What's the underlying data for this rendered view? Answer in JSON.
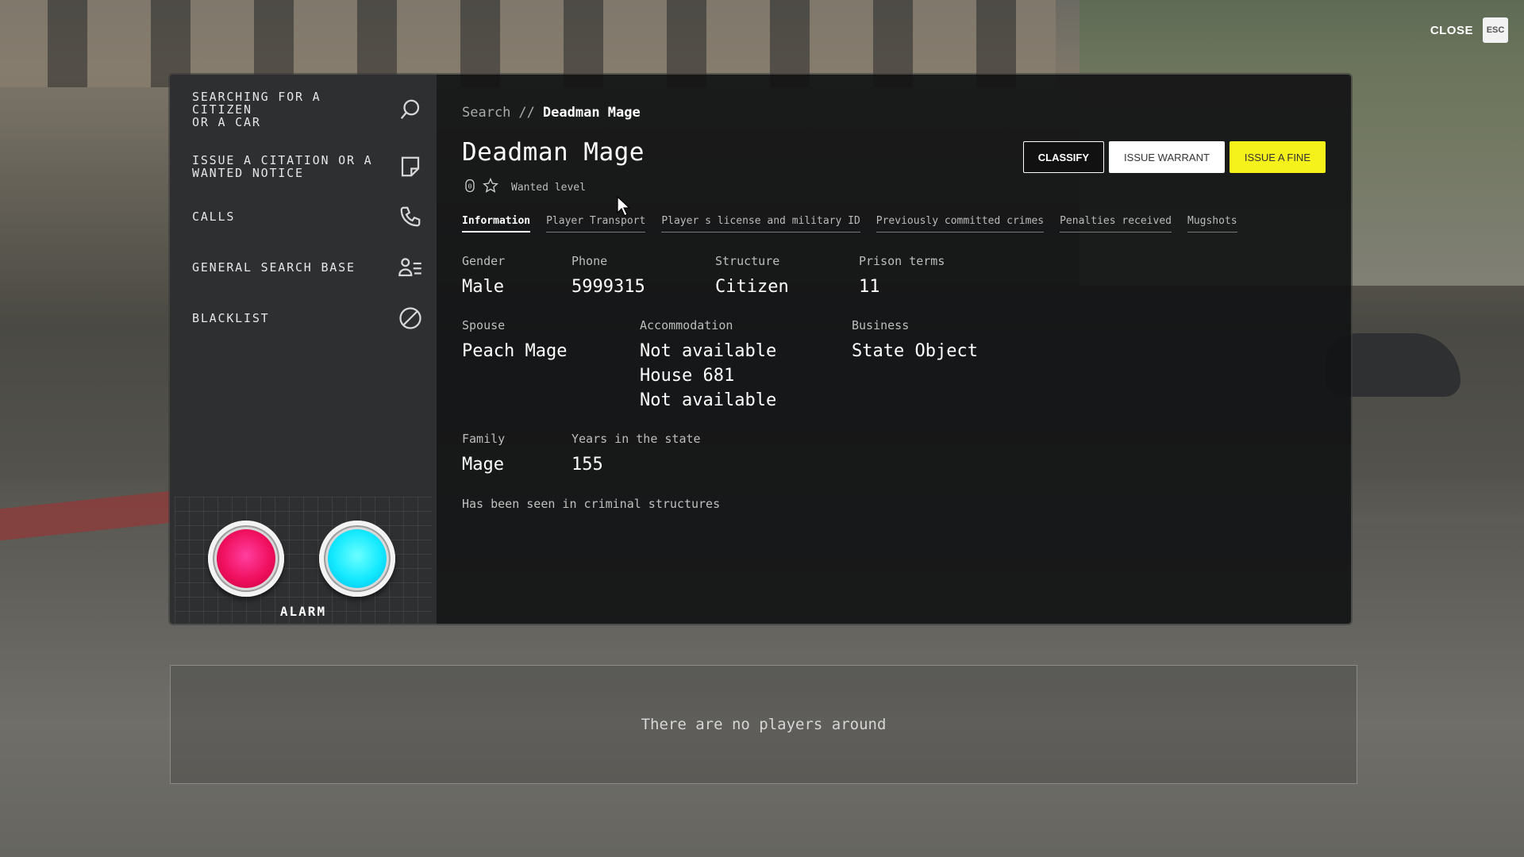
{
  "close": {
    "label": "CLOSE",
    "key": "ESC"
  },
  "sidebar": {
    "items": [
      {
        "label": "SEARCHING FOR A\nCITIZEN\nOR A CAR",
        "icon": "search-icon"
      },
      {
        "label": "ISSUE A CITATION OR A\nWANTED NOTICE",
        "icon": "note-icon"
      },
      {
        "label": "CALLS",
        "icon": "phone-icon"
      },
      {
        "label": "GENERAL SEARCH BASE",
        "icon": "user-list-icon"
      },
      {
        "label": "BLACKLIST",
        "icon": "ban-icon"
      }
    ],
    "alarm": {
      "label": "ALARM",
      "red": "#f0105f",
      "cyan": "#14e9ff"
    }
  },
  "breadcrumb": {
    "root": "Search",
    "separator": "//",
    "current": "Deadman Mage"
  },
  "profile": {
    "name": "Deadman Mage",
    "wanted_stars": 0,
    "wanted_label": "Wanted level"
  },
  "actions": {
    "classify": "CLASSIFY",
    "warrant": "ISSUE WARRANT",
    "fine": "ISSUE A FINE"
  },
  "tabs": [
    "Information",
    "Player Transport",
    "Player s license and military ID",
    "Previously committed crimes",
    "Penalties received",
    "Mugshots"
  ],
  "info": {
    "gender": {
      "label": "Gender",
      "value": "Male"
    },
    "phone": {
      "label": "Phone",
      "value": "5999315"
    },
    "structure": {
      "label": "Structure",
      "value": "Citizen"
    },
    "prison_terms": {
      "label": "Prison terms",
      "value": "11"
    },
    "spouse": {
      "label": "Spouse",
      "value": "Peach Mage"
    },
    "accommodation": {
      "label": "Accommodation",
      "values": [
        "Not available",
        "House 681",
        "Not available"
      ]
    },
    "business": {
      "label": "Business",
      "value": "State Object"
    },
    "family": {
      "label": "Family",
      "value": "Mage"
    },
    "years": {
      "label": "Years in the state",
      "value": "155"
    },
    "note": "Has been seen in criminal structures"
  },
  "players": {
    "empty_text": "There are no players around"
  },
  "colors": {
    "accent_yellow": "#f5f11a",
    "panel_bg": "#121314",
    "sidebar_bg": "#2d2f31"
  }
}
